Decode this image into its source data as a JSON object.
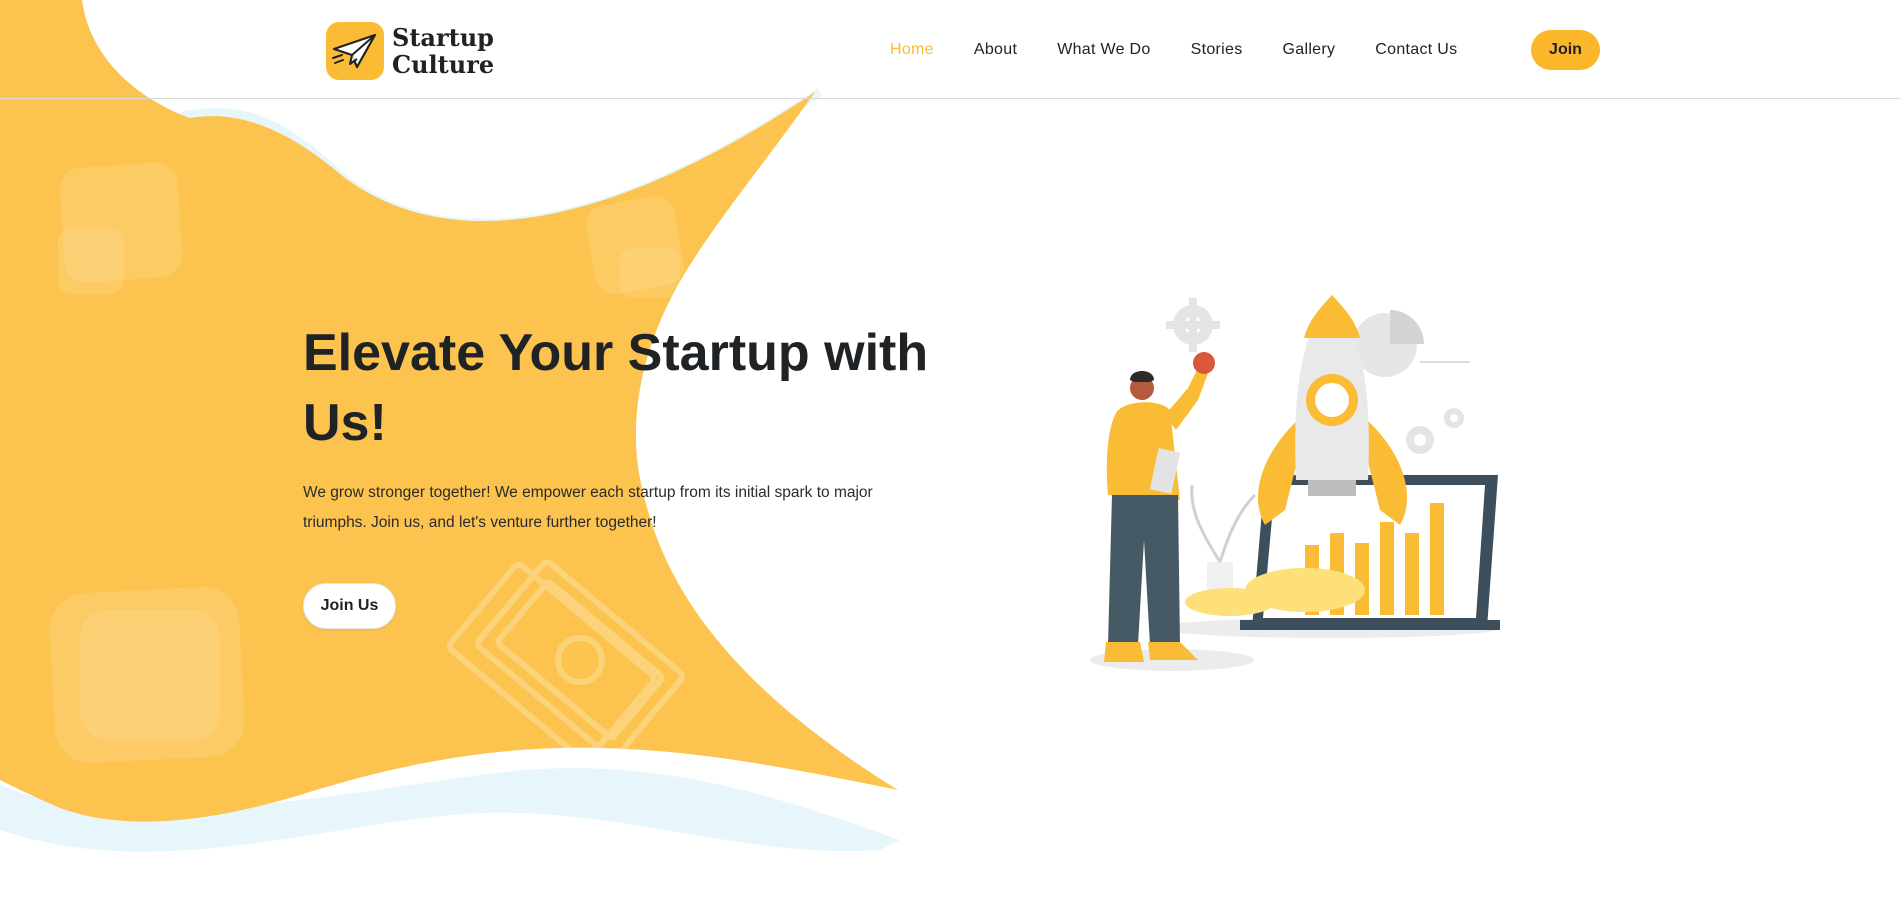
{
  "brand": {
    "line1": "Startup",
    "line2": "Culture",
    "icon": "paper-plane-icon",
    "color": "#fbbc35"
  },
  "nav": {
    "items": [
      {
        "label": "Home",
        "active": true
      },
      {
        "label": "About",
        "active": false
      },
      {
        "label": "What We Do",
        "active": false
      },
      {
        "label": "Stories",
        "active": false
      },
      {
        "label": "Gallery",
        "active": false
      },
      {
        "label": "Contact Us",
        "active": false
      }
    ],
    "join_label": "Join"
  },
  "hero": {
    "title": "Elevate Your Startup with Us!",
    "text": "We grow stronger together! We empower each startup from its initial spark to major triumphs. Join us, and let's venture further together!",
    "button_label": "Join Us"
  },
  "illustration": {
    "name": "rocket-launch-illustration"
  },
  "colors": {
    "accent": "#fbbc35",
    "blob": "#fcc44f",
    "text": "#212529",
    "wave": "#e6f6fb"
  }
}
